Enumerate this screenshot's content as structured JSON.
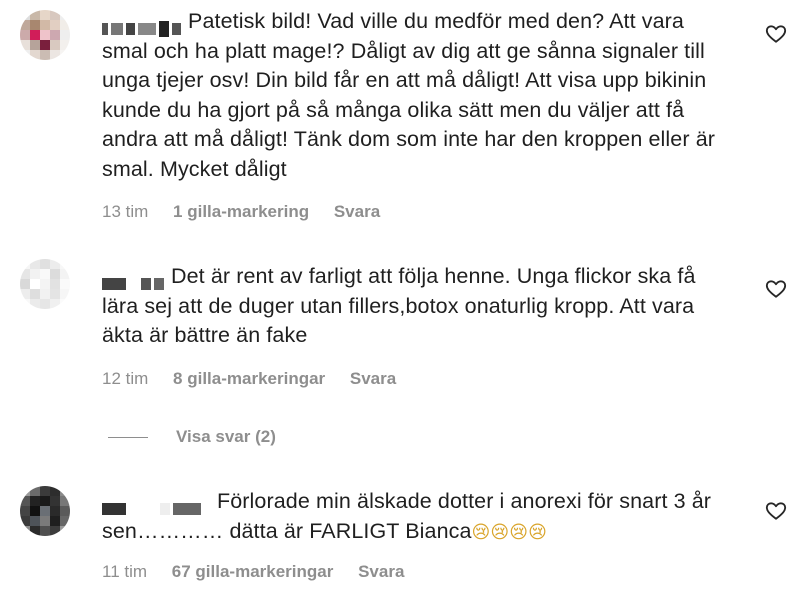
{
  "comments": [
    {
      "text": "Patetisk bild! Vad ville du medför med den? Att vara smal och ha platt mage!? Dåligt av dig att ge sånna signaler till unga tjejer osv! Din bild får en att må dåligt! Att visa upp bikinin kunde du ha gjort på så många olika sätt men du väljer att få andra att må dåligt! Tänk dom som inte har den kroppen eller är smal. Mycket dåligt",
      "time": "13 tim",
      "likes": "1 gilla-markering",
      "reply": "Svara"
    },
    {
      "text": "Det är rent av farligt att följa henne. Unga flickor ska få lära sej att de duger utan fillers,botox onaturlig kropp. Att vara äkta är bättre än fake",
      "time": "12 tim",
      "likes": "8 gilla-markeringar",
      "reply": "Svara"
    },
    {
      "text": "Förlorade min älskade dotter i anorexi för snart 3 år sen………… dätta är FARLIGT Bianca",
      "emoji": "😢😢😢😢",
      "time": "11 tim",
      "likes": "67 gilla-markeringar",
      "reply": "Svara"
    }
  ],
  "view_replies": "Visa svar (2)",
  "icons": {
    "like": "heart-outline-icon"
  },
  "colors": {
    "text": "#1f1f1f",
    "muted": "#8e8e8e",
    "background": "#ffffff"
  }
}
